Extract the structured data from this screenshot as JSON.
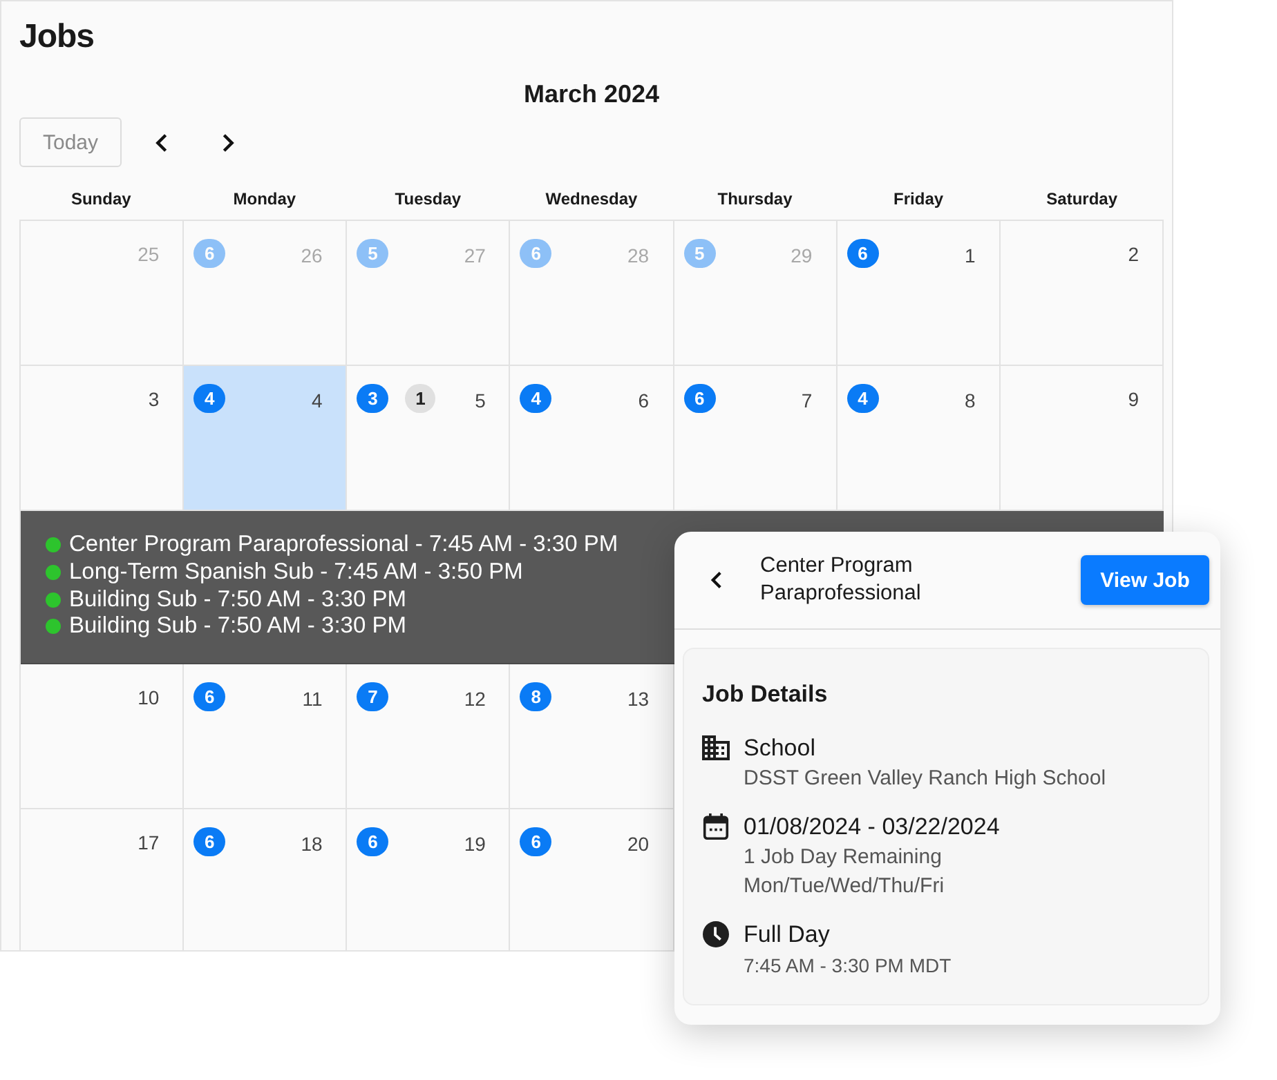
{
  "page": {
    "title": "Jobs"
  },
  "calendar": {
    "month": "March 2024",
    "today_button": "Today",
    "weekdays": [
      "Sunday",
      "Monday",
      "Tuesday",
      "Wednesday",
      "Thursday",
      "Friday",
      "Saturday"
    ],
    "weeks": [
      {
        "days": [
          {
            "date": "25",
            "outside_month": true,
            "selected": false
          },
          {
            "date": "26",
            "outside_month": true,
            "selected": false,
            "badges": [
              {
                "count": "6",
                "kind": "jobs"
              }
            ]
          },
          {
            "date": "27",
            "outside_month": true,
            "selected": false,
            "badges": [
              {
                "count": "5",
                "kind": "jobs"
              }
            ]
          },
          {
            "date": "28",
            "outside_month": true,
            "selected": false,
            "badges": [
              {
                "count": "6",
                "kind": "jobs"
              }
            ]
          },
          {
            "date": "29",
            "outside_month": true,
            "selected": false,
            "badges": [
              {
                "count": "5",
                "kind": "jobs"
              }
            ]
          },
          {
            "date": "1",
            "outside_month": false,
            "selected": false,
            "badges": [
              {
                "count": "6",
                "kind": "jobs"
              }
            ]
          },
          {
            "date": "2",
            "outside_month": false,
            "selected": false
          }
        ]
      },
      {
        "days": [
          {
            "date": "3",
            "outside_month": false,
            "selected": false
          },
          {
            "date": "4",
            "outside_month": false,
            "selected": true,
            "badges": [
              {
                "count": "4",
                "kind": "jobs"
              }
            ]
          },
          {
            "date": "5",
            "outside_month": false,
            "selected": false,
            "badges": [
              {
                "count": "3",
                "kind": "jobs"
              },
              {
                "count": "1",
                "kind": "other"
              }
            ]
          },
          {
            "date": "6",
            "outside_month": false,
            "selected": false,
            "badges": [
              {
                "count": "4",
                "kind": "jobs"
              }
            ]
          },
          {
            "date": "7",
            "outside_month": false,
            "selected": false,
            "badges": [
              {
                "count": "6",
                "kind": "jobs"
              }
            ]
          },
          {
            "date": "8",
            "outside_month": false,
            "selected": false,
            "badges": [
              {
                "count": "4",
                "kind": "jobs"
              }
            ]
          },
          {
            "date": "9",
            "outside_month": false,
            "selected": false
          }
        ],
        "tooltip": {
          "items": [
            "Center Program Paraprofessional - 7:45 AM - 3:30 PM",
            "Long-Term Spanish Sub - 7:45 AM - 3:50 PM",
            "Building Sub - 7:50 AM - 3:30 PM",
            "Building Sub - 7:50 AM - 3:30 PM"
          ]
        }
      },
      {
        "days": [
          {
            "date": "10",
            "outside_month": false,
            "selected": false
          },
          {
            "date": "11",
            "outside_month": false,
            "selected": false,
            "badges": [
              {
                "count": "6",
                "kind": "jobs"
              }
            ]
          },
          {
            "date": "12",
            "outside_month": false,
            "selected": false,
            "badges": [
              {
                "count": "7",
                "kind": "jobs"
              }
            ]
          },
          {
            "date": "13",
            "outside_month": false,
            "selected": false,
            "badges": [
              {
                "count": "8",
                "kind": "jobs"
              }
            ]
          }
        ]
      },
      {
        "days": [
          {
            "date": "17",
            "outside_month": false,
            "selected": false
          },
          {
            "date": "18",
            "outside_month": false,
            "selected": false,
            "badges": [
              {
                "count": "6",
                "kind": "jobs"
              }
            ]
          },
          {
            "date": "19",
            "outside_month": false,
            "selected": false,
            "badges": [
              {
                "count": "6",
                "kind": "jobs"
              }
            ]
          },
          {
            "date": "20",
            "outside_month": false,
            "selected": false,
            "badges": [
              {
                "count": "6",
                "kind": "jobs"
              }
            ]
          }
        ]
      }
    ]
  },
  "job_panel": {
    "title": "Center Program Paraprofessional",
    "button": "View Job",
    "section_title": "Job Details",
    "details": [
      {
        "kind": "building",
        "heading": "School",
        "lines": [
          "DSST Green Valley Ranch High School"
        ]
      },
      {
        "kind": "calendar",
        "heading": "01/08/2024 - 03/22/2024",
        "lines": [
          "1 Job Day Remaining",
          "Mon/Tue/Wed/Thu/Fri"
        ]
      },
      {
        "kind": "clock",
        "heading": "Full Day",
        "lines": [
          "7:45 AM - 3:30 PM MDT"
        ]
      }
    ]
  }
}
